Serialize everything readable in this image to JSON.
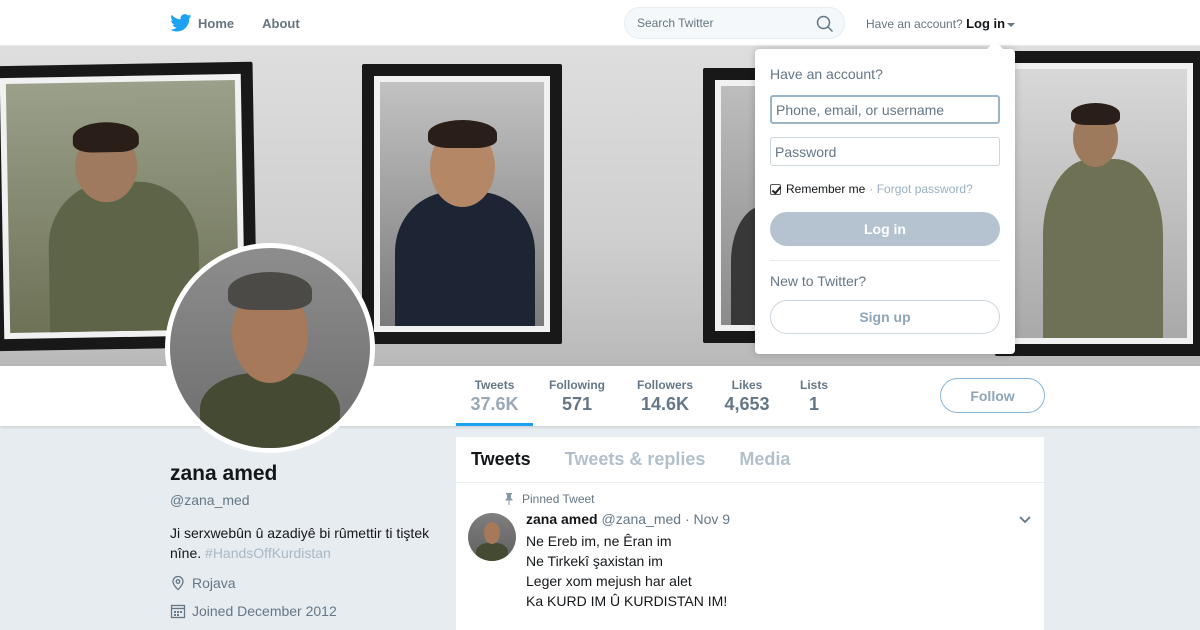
{
  "nav": {
    "home": "Home",
    "about": "About",
    "search_placeholder": "Search Twitter",
    "have_account": "Have an account?",
    "login": "Log in"
  },
  "stats": {
    "tweets": {
      "label": "Tweets",
      "value": "37.6K"
    },
    "following": {
      "label": "Following",
      "value": "571"
    },
    "followers": {
      "label": "Followers",
      "value": "14.6K"
    },
    "likes": {
      "label": "Likes",
      "value": "4,653"
    },
    "lists": {
      "label": "Lists",
      "value": "1"
    },
    "follow_button": "Follow"
  },
  "profile": {
    "name": "zana amed",
    "handle": "@zana_med",
    "bio": "Ji serxwebûn û azadiyê bi rûmettir ti tiştek nîne.",
    "hashtag": "#HandsOffKurdistan",
    "location": "Rojava",
    "joined": "Joined December 2012"
  },
  "timeline": {
    "tabs": [
      "Tweets",
      "Tweets & replies",
      "Media"
    ],
    "pinned_label": "Pinned Tweet",
    "tweet": {
      "name": "zana amed",
      "handle": "@zana_med",
      "date": "· Nov 9",
      "lines": [
        "Ne Ereb im, ne Êran im",
        "Ne Tirkekî şaxistan im",
        "Leger xom mejush har alet",
        "Ka KURD IM Û KURDISTAN IM!"
      ]
    }
  },
  "login_dropdown": {
    "title": "Have an account?",
    "username_placeholder": "Phone, email, or username",
    "password_placeholder": "Password",
    "remember": "Remember me",
    "forgot": "· Forgot password?",
    "login_button": "Log in",
    "new_prompt": "New to Twitter?",
    "signup_button": "Sign up"
  },
  "colors": {
    "brand": "#1da1f2",
    "background": "#e6ecf0",
    "muted_text": "#657786"
  }
}
